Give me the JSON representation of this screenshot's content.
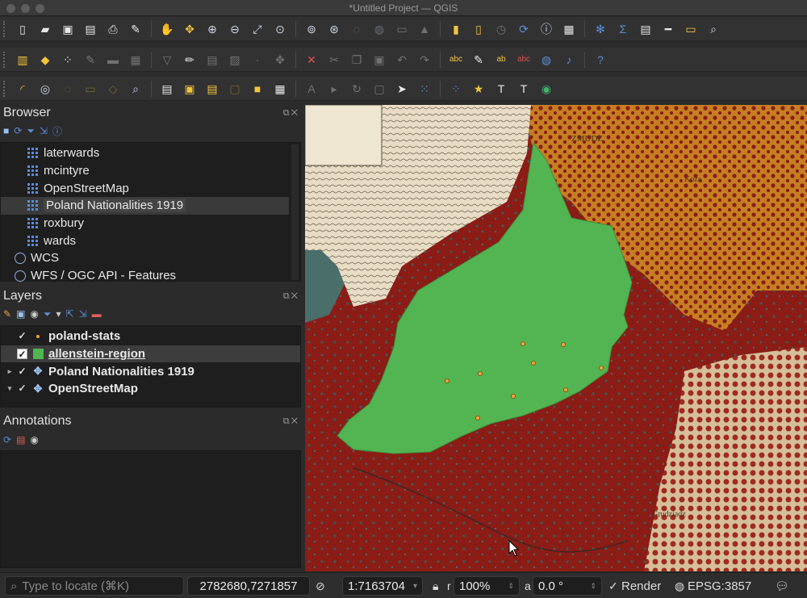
{
  "window": {
    "title": "*Untitled Project — QGIS"
  },
  "colors": {
    "accent_blue": "#5b8dd6",
    "region_fill": "#52b551",
    "point_fill": "#f1a53c",
    "map_red": "#8b1c16",
    "map_orange": "#c57f22",
    "map_paper": "#e3d8bf"
  },
  "toolbars": {
    "row1": [
      "new-project-icon",
      "open-project-icon",
      "save-project-icon",
      "save-as-icon",
      "print-layout-icon",
      "style-manager-icon",
      "pan-hand-icon",
      "pan-to-selection-icon",
      "zoom-in-icon",
      "zoom-out-icon",
      "zoom-full-icon",
      "zoom-to-selection-icon",
      "zoom-to-layer-icon",
      "zoom-native-icon",
      "zoom-last-icon",
      "zoom-next-icon",
      "new-map-view-icon",
      "new-3d-view-icon",
      "bookmark-icon",
      "show-bookmarks-icon",
      "temporal-icon",
      "refresh-icon",
      "identify-icon",
      "attribute-table-icon",
      "settings-icon",
      "statistics-icon",
      "table-icon",
      "measure-icon",
      "tips-icon",
      "search-icon"
    ],
    "row2": [
      "data-source-manager-icon",
      "new-geopackage-icon",
      "new-shapefile-icon",
      "digitize-icon",
      "vertex-icon",
      "virtual-layer-icon",
      "mesh-icon",
      "pencil-icon",
      "save-edits-icon",
      "add-polygon-icon",
      "add-point-icon",
      "move-feature-icon",
      "delete-icon",
      "cut-icon",
      "copy-icon",
      "paste-icon",
      "undo-icon",
      "redo-icon",
      "label-abc-icon",
      "label-pin-icon",
      "label-show-icon",
      "label-hide-icon",
      "globe-icon",
      "python-icon",
      "help-icon"
    ],
    "row3": [
      "select-icon",
      "identify-small-icon",
      "deselect-icon",
      "select-polygon-icon",
      "select-freehand-icon",
      "locator-icon",
      "metadata-icon",
      "select-features-icon",
      "select-by-expression-icon",
      "deselect-all-icon",
      "select-location-icon",
      "open-field-calc-icon",
      "move-label-icon",
      "pin-labels-icon",
      "rotate-label-icon",
      "change-label-icon",
      "cursor-icon",
      "node-tool-icon",
      "vertex-tool-icon",
      "favorite-star-icon",
      "text-annotation-icon",
      "text-tool-icon",
      "share-icon"
    ]
  },
  "browser": {
    "title": "Browser",
    "items": [
      {
        "label": "laterwards",
        "icon": "grid-layer-icon",
        "indent": true
      },
      {
        "label": "mcintyre",
        "icon": "grid-layer-icon",
        "indent": true
      },
      {
        "label": "OpenStreetMap",
        "icon": "grid-layer-icon",
        "indent": true
      },
      {
        "label": "Poland Nationalities 1919",
        "icon": "grid-layer-icon",
        "indent": true,
        "selected": true
      },
      {
        "label": "roxbury",
        "icon": "grid-layer-icon",
        "indent": true
      },
      {
        "label": "wards",
        "icon": "grid-layer-icon",
        "indent": true
      },
      {
        "label": "WCS",
        "icon": "globe-icon",
        "indent": false
      },
      {
        "label": "WFS / OGC API - Features",
        "icon": "globe-icon",
        "indent": false
      }
    ]
  },
  "layers": {
    "title": "Layers",
    "items": [
      {
        "label": "poland-stats",
        "checked": true,
        "symbol": "point",
        "expander": ""
      },
      {
        "label": "allenstein-region",
        "checked": true,
        "symbol": "polygon",
        "expander": "",
        "selected": true,
        "checkbox_box": true
      },
      {
        "label": "Poland Nationalities 1919",
        "checked": true,
        "symbol": "raster",
        "expander": "collapsed"
      },
      {
        "label": "OpenStreetMap",
        "checked": true,
        "symbol": "raster",
        "expander": "expanded"
      }
    ]
  },
  "annotations": {
    "title": "Annotations"
  },
  "map": {
    "label_zmudz": "ZMUDZ",
    "label_koza": "Koza",
    "label_grudziadz": "Grudziadz"
  },
  "status": {
    "locate_placeholder": "Type to locate (⌘K)",
    "coordinate": "2782680,7271857",
    "scale": "1:7163704",
    "magnifier_label": "r",
    "magnifier": "100%",
    "rotation_label": "a",
    "rotation": "0.0 °",
    "render_label": "Render",
    "render_checked": "✓",
    "crs": "EPSG:3857",
    "messages_icon": "speech-bubble-icon"
  }
}
